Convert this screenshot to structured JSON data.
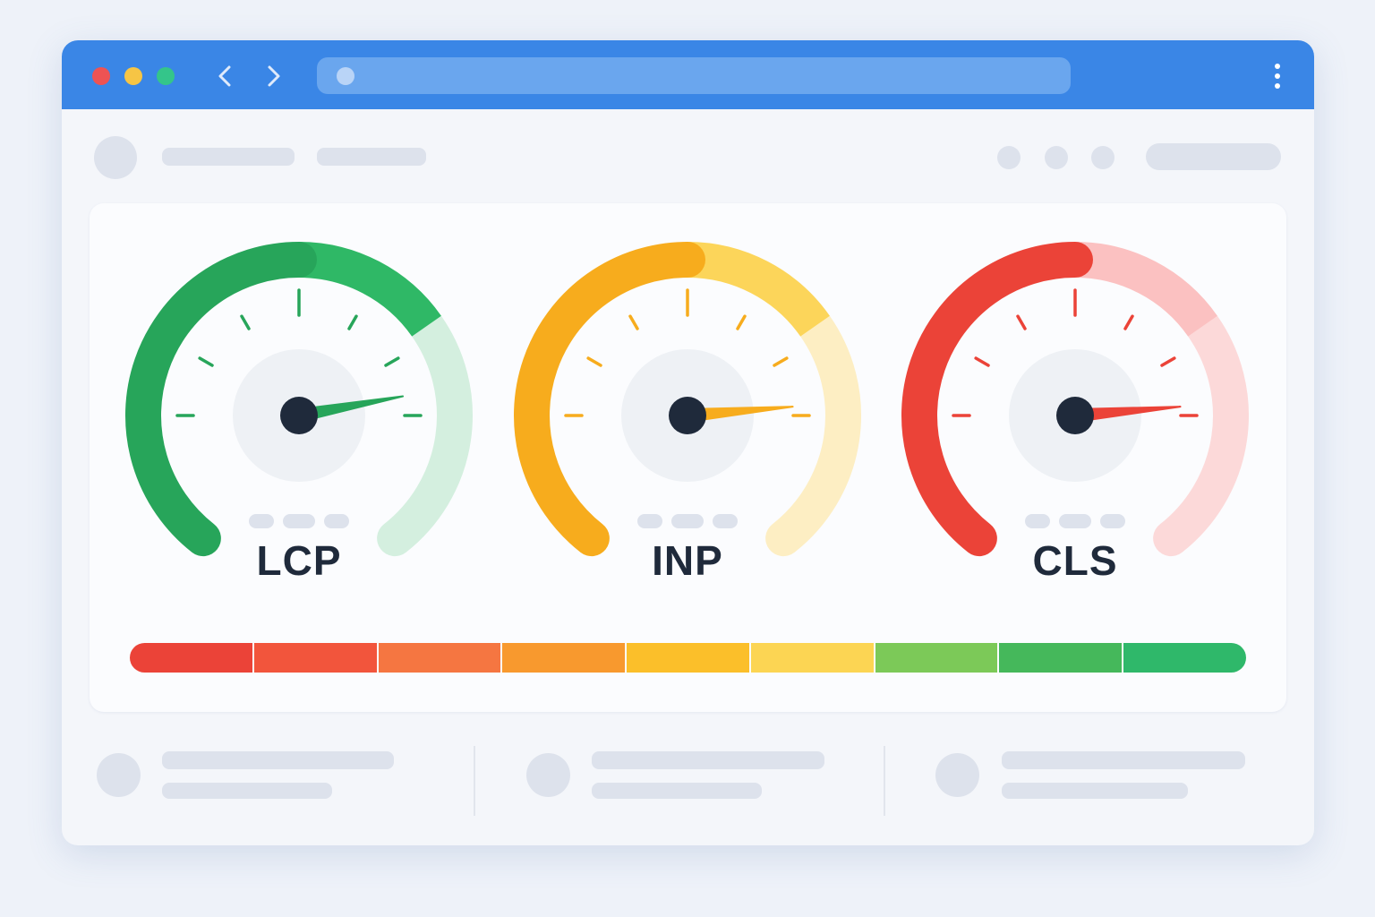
{
  "browser": {
    "traffic_lights": [
      {
        "name": "close",
        "color": "#ee5353"
      },
      {
        "name": "minimize",
        "color": "#f6c545"
      },
      {
        "name": "maximize",
        "color": "#34c58a"
      }
    ],
    "nav_icons": [
      "chevron-left-icon",
      "chevron-right-icon"
    ],
    "menu_icon": "vertical-dots-icon"
  },
  "gauges": [
    {
      "label": "LCP",
      "value_fraction": 0.78,
      "color": "#27a55a",
      "light_color": "#d4efdf",
      "mid_color": "#2fb866"
    },
    {
      "label": "INP",
      "value_fraction": 0.8,
      "color": "#f7ac1d",
      "light_color": "#fdeec3",
      "mid_color": "#fcd55a"
    },
    {
      "label": "CLS",
      "value_fraction": 0.8,
      "color": "#eb4338",
      "light_color": "#fcd9d9",
      "mid_color": "#fbc1c1"
    }
  ],
  "scale_colors": [
    "#eb4338",
    "#f2553c",
    "#f57641",
    "#f8992e",
    "#fbbf2a",
    "#fcd553",
    "#7cc958",
    "#45b85b",
    "#2fb86a"
  ],
  "colors": {
    "accent": "#3a86e6",
    "needle_hub": "#1f2a3b",
    "placeholder": "#dde2ec"
  }
}
